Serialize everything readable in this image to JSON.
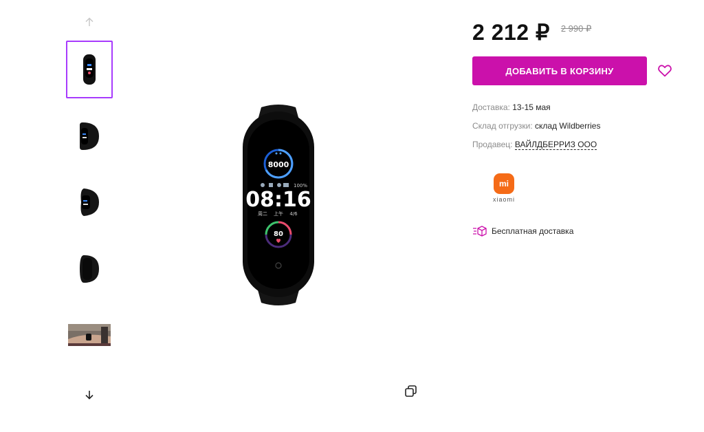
{
  "gallery": {
    "thumbnails": [
      "band-front",
      "band-side-left",
      "band-side-right",
      "band-back",
      "band-on-wrist"
    ]
  },
  "product": {
    "price": "2 212 ₽",
    "old_price": "2 990 ₽",
    "add_to_cart_label": "ДОБАВИТЬ В КОРЗИНУ"
  },
  "delivery": {
    "label": "Доставка:",
    "value": "13-15 мая"
  },
  "warehouse": {
    "label": "Склад отгрузки:",
    "value": "склад Wildberries"
  },
  "seller": {
    "label": "Продавец:",
    "value": "ВАЙЛДБЕРРИЗ ООО"
  },
  "brand": {
    "logo_text": "mi",
    "name": "xiaomi"
  },
  "free_shipping": "Бесплатная доставка",
  "screen": {
    "steps": "8000",
    "time": "08:16",
    "battery": "100%",
    "date_left": "周二",
    "date_mid": "上午",
    "date_right": "4/6",
    "heart_rate": "80"
  },
  "colors": {
    "accent": "#cb11ab",
    "thumb_border": "#a73afd",
    "brand_orange": "#f56b17"
  }
}
